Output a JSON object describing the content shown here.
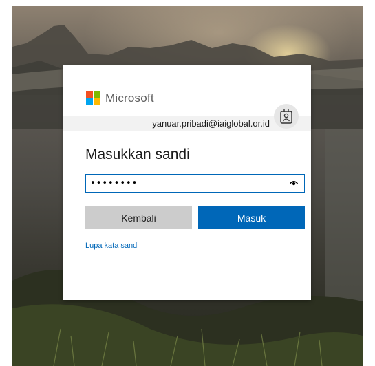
{
  "brand": {
    "name": "Microsoft",
    "logo_colors": [
      "#f25022",
      "#7fba00",
      "#00a4ef",
      "#ffb900"
    ],
    "accent": "#0067b8"
  },
  "identity": {
    "email": "yanuar.pribadi@iaiglobal.or.id",
    "badge_icon": "id-badge-icon"
  },
  "form": {
    "title": "Masukkan sandi",
    "password_value": "••••••••",
    "reveal_icon": "eye-icon",
    "back_label": "Kembali",
    "submit_label": "Masuk",
    "forgot_link": "Lupa kata sandi"
  }
}
